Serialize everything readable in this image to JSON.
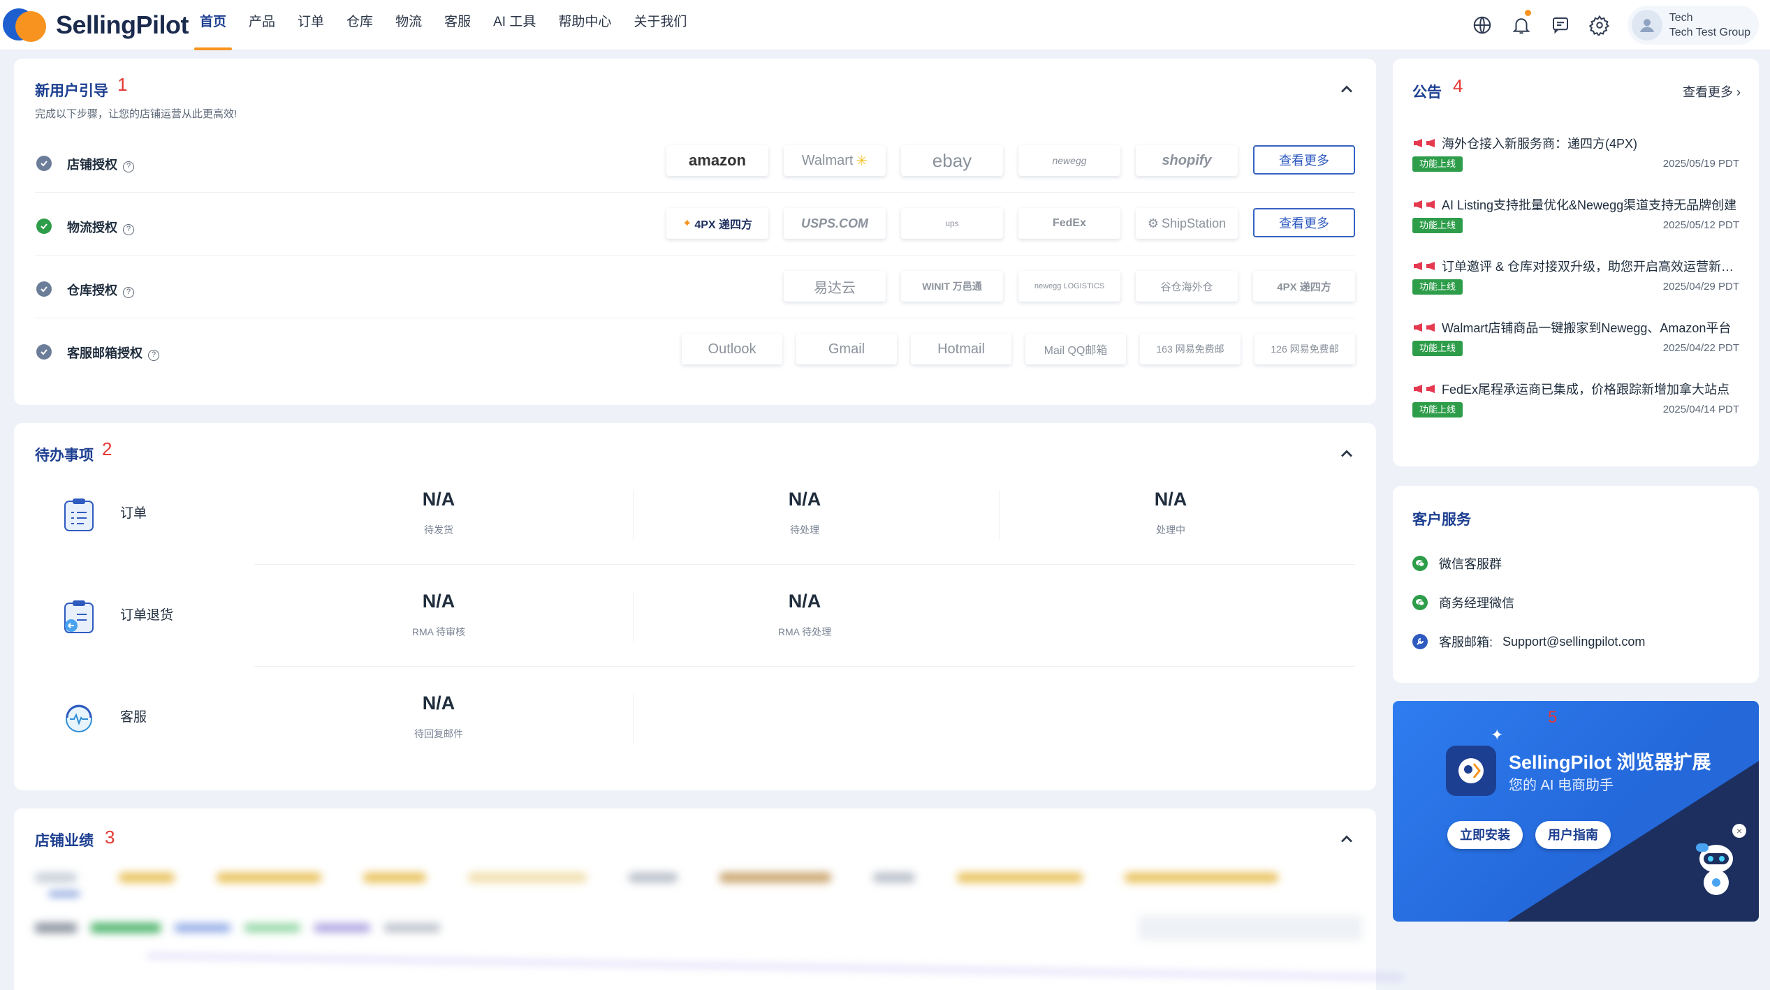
{
  "brand": {
    "name": "SellingPilot"
  },
  "nav": {
    "items": [
      "首页",
      "产品",
      "订单",
      "仓库",
      "物流",
      "客服",
      "AI 工具",
      "帮助中心",
      "关于我们"
    ],
    "active_index": 0
  },
  "user": {
    "name": "Tech",
    "group": "Tech Test Group"
  },
  "header_icons": [
    "globe-icon",
    "bell-icon",
    "chat-icon",
    "gear-icon",
    "user-avatar-icon"
  ],
  "guide": {
    "title": "新用户引导",
    "marker": "1",
    "subtitle": "完成以下步骤，让您的店铺运营从此更高效!",
    "rows": [
      {
        "label": "店铺授权",
        "done": false,
        "logos": [
          "amazon",
          "Walmart",
          "ebay",
          "newegg",
          "shopify"
        ],
        "see_more": "查看更多"
      },
      {
        "label": "物流授权",
        "done": true,
        "logos": [
          "4PX 递四方",
          "USPS.COM",
          "ups",
          "FedEx",
          "ShipStation"
        ],
        "see_more": "查看更多"
      },
      {
        "label": "仓库授权",
        "done": false,
        "logos": [
          "易达云",
          "WINIT 万邑通",
          "newegg LOGISTICS",
          "谷仓海外仓",
          "4PX 递四方"
        ]
      },
      {
        "label": "客服邮箱授权",
        "done": false,
        "logos": [
          "Outlook",
          "Gmail",
          "Hotmail",
          "Mail QQ邮箱",
          "163 网易免费邮",
          "126 网易免费邮"
        ]
      }
    ]
  },
  "todo": {
    "title": "待办事项",
    "marker": "2",
    "rows": [
      {
        "name": "订单",
        "stats": [
          {
            "value": "N/A",
            "label": "待发货"
          },
          {
            "value": "N/A",
            "label": "待处理"
          },
          {
            "value": "N/A",
            "label": "处理中"
          }
        ]
      },
      {
        "name": "订单退货",
        "stats": [
          {
            "value": "N/A",
            "label": "RMA 待审核"
          },
          {
            "value": "N/A",
            "label": "RMA 待处理"
          }
        ]
      },
      {
        "name": "客服",
        "stats": [
          {
            "value": "N/A",
            "label": "待回复邮件"
          }
        ]
      }
    ]
  },
  "performance": {
    "title": "店铺业绩",
    "marker": "3"
  },
  "announcements": {
    "title": "公告",
    "marker": "4",
    "more": "查看更多",
    "items": [
      {
        "title": "海外仓接入新服务商：递四方(4PX)",
        "tag": "功能上线",
        "date": "2025/05/19 PDT"
      },
      {
        "title": "AI Listing支持批量优化&Newegg渠道支持无品牌创建",
        "tag": "功能上线",
        "date": "2025/05/12 PDT"
      },
      {
        "title": "订单邀评 & 仓库对接双升级，助您开启高效运营新篇章",
        "tag": "功能上线",
        "date": "2025/04/29 PDT"
      },
      {
        "title": "Walmart店铺商品一键搬家到Newegg、Amazon平台",
        "tag": "功能上线",
        "date": "2025/04/22 PDT"
      },
      {
        "title": "FedEx尾程承运商已集成，价格跟踪新增加拿大站点",
        "tag": "功能上线",
        "date": "2025/04/14 PDT"
      }
    ]
  },
  "service": {
    "title": "客户服务",
    "items": [
      {
        "label": "微信客服群",
        "color": "#2e9d4a"
      },
      {
        "label": "商务经理微信",
        "color": "#2e9d4a"
      },
      {
        "label": "客服邮箱:",
        "email": "Support@sellingpilot.com",
        "color": "#2f5bc0"
      }
    ]
  },
  "promo": {
    "marker": "5",
    "title": "SellingPilot 浏览器扩展",
    "subtitle": "您的 AI 电商助手",
    "install": "立即安装",
    "guide": "用户指南",
    "close": "×"
  },
  "colors": {
    "primary": "#1d3f91",
    "accent": "#f7931e",
    "success": "#2e9d4a",
    "marker": "#e53935"
  }
}
